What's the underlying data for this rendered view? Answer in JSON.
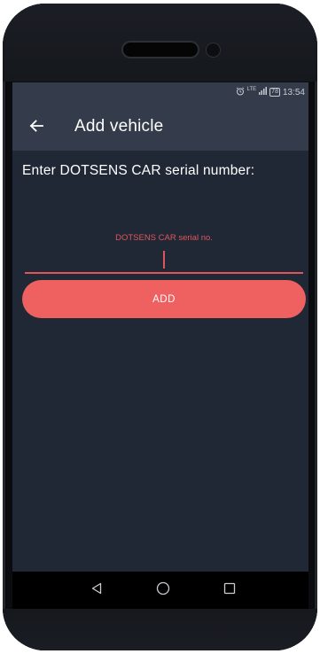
{
  "status_bar": {
    "alarm_icon": "alarm-clock-icon",
    "network_label": "LTE",
    "signal_icon": "signal-bars-icon",
    "battery_level": "78",
    "time": "13:54"
  },
  "app_bar": {
    "back_icon": "arrow-left-icon",
    "title": "Add vehicle"
  },
  "form": {
    "prompt": "Enter DOTSENS CAR serial number:",
    "serial_field": {
      "label": "DOTSENS CAR serial no.",
      "value": "",
      "placeholder": ""
    },
    "add_button_label": "ADD"
  },
  "nav_bar": {
    "back_icon": "nav-back-triangle-icon",
    "home_icon": "nav-home-circle-icon",
    "recents_icon": "nav-recents-square-icon"
  },
  "colors": {
    "background": "#202836",
    "app_bar": "#343c4b",
    "accent": "#ef6060",
    "field_accent": "#e0555b",
    "text": "#ffffff"
  }
}
